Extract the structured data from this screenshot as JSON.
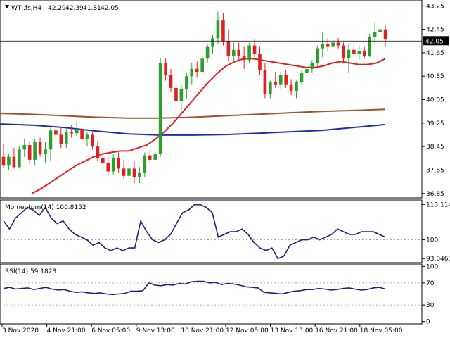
{
  "header": {
    "symbol": "WTI.fs,H4",
    "open": "42.29",
    "high": "42.39",
    "low": "41.81",
    "close": "42.05"
  },
  "price_panel": {
    "y_ticks": [
      "43.25",
      "42.45",
      "41.65",
      "40.85",
      "40.05",
      "39.25",
      "38.45",
      "37.65",
      "36.85"
    ],
    "current_price_label": "42.05",
    "current_price": 42.05
  },
  "momentum_panel": {
    "title": "Momentum(14) 100.8152",
    "y_ticks": [
      "113.1143",
      "100",
      "93.0463"
    ]
  },
  "rsi_panel": {
    "title": "RSI(14) 59.1823",
    "y_ticks": [
      "100",
      "70",
      "30",
      "0"
    ]
  },
  "x_axis": {
    "labels": [
      "3 Nov 2020",
      "4 Nov 21:00",
      "6 Nov 05:00",
      "9 Nov 13:00",
      "10 Nov 21:00",
      "12 Nov 05:00",
      "13 Nov 13:00",
      "16 Nov 21:00",
      "18 Nov 05:00"
    ]
  },
  "colors": {
    "bull": "#2ca02c",
    "bear": "#e02020",
    "ma_fast": "#e02020",
    "ma_mid": "#a0522d",
    "ma_slow": "#1f2ea8",
    "osc": "#1a237e",
    "frame": "#000000"
  },
  "chart_data": [
    {
      "type": "candlestick",
      "symbol": "WTI.fs",
      "timeframe": "H4",
      "ylim": [
        36.85,
        43.35
      ],
      "candles": [
        [
          38.1,
          38.55,
          37.7,
          37.8
        ],
        [
          37.8,
          38.2,
          37.65,
          38.1
        ],
        [
          38.1,
          38.4,
          37.7,
          37.75
        ],
        [
          37.75,
          38.45,
          37.7,
          38.35
        ],
        [
          38.35,
          38.7,
          38.1,
          38.5
        ],
        [
          38.5,
          38.65,
          37.85,
          38.0
        ],
        [
          38.0,
          38.7,
          37.8,
          38.6
        ],
        [
          38.6,
          38.75,
          38.1,
          38.2
        ],
        [
          38.2,
          38.6,
          37.9,
          38.35
        ],
        [
          38.35,
          39.1,
          37.95,
          39.0
        ],
        [
          39.0,
          39.15,
          38.7,
          38.85
        ],
        [
          38.85,
          39.1,
          38.4,
          38.55
        ],
        [
          38.55,
          39.05,
          38.4,
          38.95
        ],
        [
          38.95,
          39.2,
          38.75,
          38.9
        ],
        [
          38.9,
          39.3,
          38.8,
          39.05
        ],
        [
          39.05,
          39.15,
          38.55,
          38.7
        ],
        [
          38.7,
          38.95,
          38.45,
          38.85
        ],
        [
          38.85,
          38.95,
          38.35,
          38.45
        ],
        [
          38.45,
          38.65,
          37.95,
          38.05
        ],
        [
          38.05,
          38.35,
          37.8,
          37.9
        ],
        [
          37.9,
          38.1,
          37.45,
          37.6
        ],
        [
          37.6,
          38.2,
          37.5,
          38.05
        ],
        [
          38.05,
          38.25,
          37.55,
          37.7
        ],
        [
          37.7,
          38.0,
          37.35,
          37.45
        ],
        [
          37.45,
          37.8,
          37.15,
          37.7
        ],
        [
          37.7,
          37.95,
          37.2,
          37.4
        ],
        [
          37.4,
          37.75,
          37.2,
          37.55
        ],
        [
          37.55,
          38.25,
          37.4,
          38.15
        ],
        [
          38.15,
          38.35,
          37.9,
          38.0
        ],
        [
          38.0,
          38.3,
          37.95,
          38.2
        ],
        [
          38.2,
          41.45,
          38.1,
          41.3
        ],
        [
          41.3,
          41.45,
          40.7,
          40.9
        ],
        [
          40.9,
          41.1,
          40.3,
          40.45
        ],
        [
          40.45,
          40.8,
          39.95,
          40.0
        ],
        [
          40.0,
          40.55,
          39.7,
          40.4
        ],
        [
          40.4,
          40.95,
          40.1,
          40.85
        ],
        [
          40.85,
          41.3,
          40.55,
          41.1
        ],
        [
          41.1,
          41.35,
          40.8,
          41.0
        ],
        [
          41.0,
          41.55,
          40.9,
          41.45
        ],
        [
          41.45,
          41.95,
          41.3,
          41.85
        ],
        [
          41.85,
          42.25,
          41.6,
          42.15
        ],
        [
          42.15,
          43.05,
          41.95,
          42.75
        ],
        [
          42.75,
          43.0,
          41.9,
          42.05
        ],
        [
          42.05,
          42.45,
          41.35,
          41.55
        ],
        [
          41.55,
          42.0,
          41.3,
          41.75
        ],
        [
          41.75,
          42.0,
          41.35,
          41.55
        ],
        [
          41.55,
          41.85,
          41.1,
          41.4
        ],
        [
          41.4,
          42.0,
          41.3,
          41.9
        ],
        [
          41.9,
          42.1,
          41.5,
          41.6
        ],
        [
          41.6,
          41.85,
          40.9,
          41.05
        ],
        [
          41.05,
          41.3,
          40.1,
          40.25
        ],
        [
          40.25,
          40.7,
          40.1,
          40.65
        ],
        [
          40.65,
          41.0,
          40.45,
          40.55
        ],
        [
          40.55,
          41.0,
          40.4,
          40.9
        ],
        [
          40.9,
          41.05,
          40.45,
          40.55
        ],
        [
          40.55,
          40.75,
          40.2,
          40.35
        ],
        [
          40.35,
          40.7,
          40.1,
          40.65
        ],
        [
          40.65,
          41.05,
          40.55,
          40.95
        ],
        [
          40.95,
          41.2,
          40.8,
          41.1
        ],
        [
          41.1,
          41.4,
          40.95,
          41.3
        ],
        [
          41.3,
          41.9,
          41.2,
          41.8
        ],
        [
          41.8,
          42.35,
          41.5,
          41.95
        ],
        [
          41.95,
          42.15,
          41.7,
          41.85
        ],
        [
          41.85,
          42.1,
          41.75,
          42.0
        ],
        [
          42.0,
          42.15,
          41.8,
          41.9
        ],
        [
          41.9,
          42.0,
          41.35,
          41.45
        ],
        [
          41.45,
          41.95,
          40.95,
          41.75
        ],
        [
          41.75,
          41.95,
          41.45,
          41.6
        ],
        [
          41.6,
          41.9,
          41.4,
          41.7
        ],
        [
          41.7,
          41.85,
          41.45,
          41.55
        ],
        [
          41.55,
          42.3,
          41.5,
          42.2
        ],
        [
          42.2,
          42.7,
          41.95,
          42.35
        ],
        [
          42.35,
          42.55,
          41.9,
          42.45
        ],
        [
          42.45,
          42.6,
          41.85,
          42.1
        ]
      ],
      "moving_averages": [
        {
          "color": "#e02020",
          "values": [
            36.85,
            37.0,
            37.2,
            37.4,
            37.6,
            37.8,
            37.95,
            38.1,
            38.2,
            38.25,
            38.3,
            38.3,
            38.4,
            38.5,
            38.7,
            38.95,
            39.25,
            39.6,
            39.95,
            40.3,
            40.65,
            40.95,
            41.2,
            41.35,
            41.45,
            41.45,
            41.4,
            41.35,
            41.3,
            41.25,
            41.2,
            41.15,
            41.15,
            41.2,
            41.3,
            41.35,
            41.3,
            41.25,
            41.25,
            41.3,
            41.45
          ]
        },
        {
          "color": "#a0522d",
          "values": [
            39.58,
            39.55,
            39.5,
            39.45,
            39.42,
            39.42,
            39.45,
            39.5,
            39.55,
            39.6,
            39.65,
            39.68,
            39.72
          ]
        },
        {
          "color": "#1f2ea8",
          "values": [
            39.22,
            39.18,
            39.1,
            38.98,
            38.88,
            38.84,
            38.84,
            38.86,
            38.9,
            38.95,
            39.0,
            39.1,
            39.2
          ]
        }
      ]
    },
    {
      "type": "line",
      "name": "Momentum(14)",
      "last_value": 100.8152,
      "ylim": [
        93.0463,
        113.1143
      ],
      "values": [
        107,
        104,
        108,
        110,
        112,
        111,
        109,
        112,
        108,
        106,
        107,
        104,
        102,
        101,
        100,
        98,
        99,
        97,
        96,
        97,
        96,
        97,
        97,
        107,
        103,
        100,
        99,
        100,
        102,
        106,
        110,
        111,
        113,
        113,
        112,
        110,
        101,
        102,
        103,
        103,
        104,
        102,
        99,
        97,
        96,
        97,
        93,
        94,
        98,
        99,
        100,
        100,
        101,
        100,
        101,
        102,
        104,
        103,
        102,
        102,
        103,
        103,
        103,
        102,
        101
      ]
    },
    {
      "type": "line",
      "name": "RSI(14)",
      "last_value": 59.1823,
      "ylim": [
        0,
        100
      ],
      "values": [
        60,
        62,
        59,
        60,
        61,
        58,
        60,
        62,
        59,
        57,
        58,
        55,
        53,
        54,
        52,
        51,
        52,
        50,
        49,
        50,
        51,
        55,
        55,
        56,
        70,
        66,
        65,
        67,
        66,
        69,
        68,
        72,
        73,
        73,
        70,
        71,
        67,
        69,
        68,
        66,
        63,
        62,
        61,
        53,
        52,
        51,
        50,
        53,
        55,
        56,
        58,
        58,
        60,
        59,
        57,
        58,
        60,
        61,
        59,
        57,
        58,
        61,
        62,
        59
      ]
    }
  ]
}
